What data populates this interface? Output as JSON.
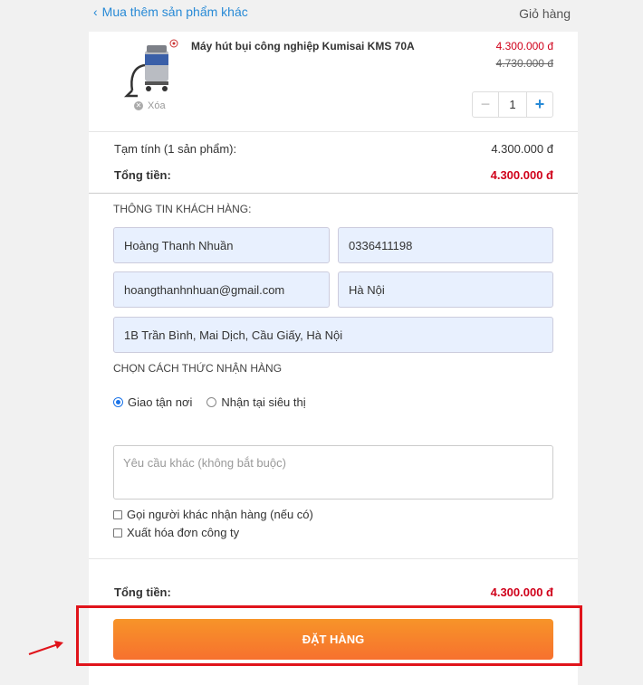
{
  "header": {
    "back_label": "Mua thêm sản phẩm khác",
    "cart_title": "Giỏ hàng"
  },
  "cart": {
    "item": {
      "name": "Máy hút bụi công nghiệp Kumisai KMS 70A",
      "price": "4.300.000 đ",
      "old_price": "4.730.000 đ",
      "remove_label": "Xóa",
      "quantity": "1",
      "image_icon": "vacuum-cleaner-icon"
    },
    "subtotal_label": "Tạm tính (1 sản phẩm):",
    "subtotal_value": "4.300.000 đ",
    "total_label": "Tổng tiền:",
    "total_value": "4.300.000 đ"
  },
  "customer": {
    "section_title": "THÔNG TIN KHÁCH HÀNG:",
    "name": "Hoàng Thanh Nhuần",
    "phone": "0336411198",
    "email": "hoangthanhnhuan@gmail.com",
    "city": "Hà Nội",
    "address": "1B Trần Bình, Mai Dịch, Cầu Giấy, Hà Nội"
  },
  "delivery": {
    "section_title": "CHỌN CÁCH THỨC NHẬN HÀNG",
    "option_home": "Giao tận nơi",
    "option_store": "Nhận tại siêu thị",
    "selected": "Giao tận nơi"
  },
  "extra": {
    "request_placeholder": "Yêu cầu khác (không bắt buộc)",
    "call_other_label": "Gọi người khác nhận hàng (nếu có)",
    "invoice_label": "Xuất hóa đơn công ty"
  },
  "summary": {
    "total_label": "Tổng tiền:",
    "total_value": "4.300.000 đ",
    "order_button": "ĐẶT HÀNG"
  },
  "colors": {
    "accent_blue": "#288ad6",
    "price_red": "#d0021b",
    "button_orange": "#f7712e",
    "highlight_red": "#e0141b"
  }
}
